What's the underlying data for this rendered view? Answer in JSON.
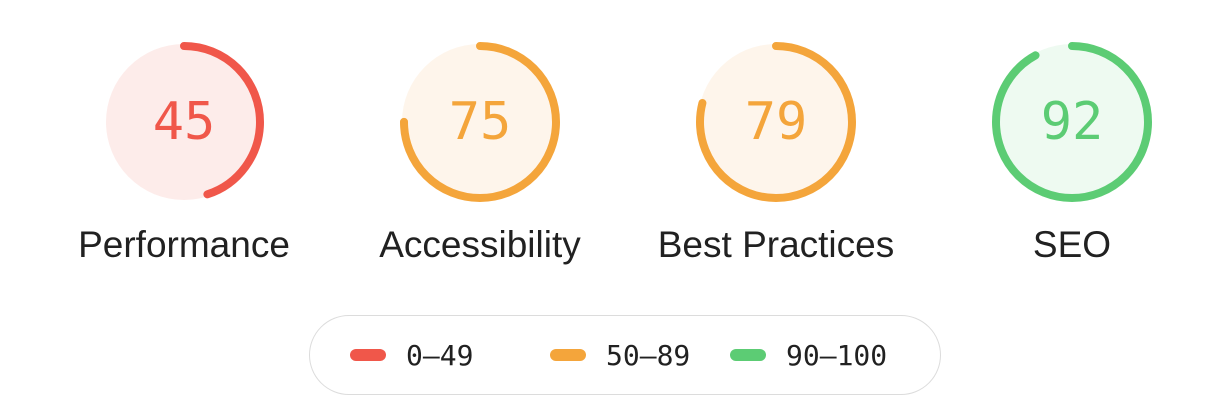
{
  "scores": [
    {
      "label": "Performance",
      "value": "45",
      "score": 45,
      "color": "#f0574a",
      "track_fill": "#fdecea"
    },
    {
      "label": "Accessibility",
      "value": "75",
      "score": 75,
      "color": "#f4a53b",
      "track_fill": "#fef5eb"
    },
    {
      "label": "Best Practices",
      "value": "79",
      "score": 79,
      "color": "#f4a53b",
      "track_fill": "#fef5eb"
    },
    {
      "label": "SEO",
      "value": "92",
      "score": 92,
      "color": "#5ccc74",
      "track_fill": "#eefaf1"
    }
  ],
  "legend": [
    {
      "label": "0–49",
      "color": "#f0574a"
    },
    {
      "label": "50–89",
      "color": "#f4a53b"
    },
    {
      "label": "90–100",
      "color": "#5ccc74"
    }
  ]
}
